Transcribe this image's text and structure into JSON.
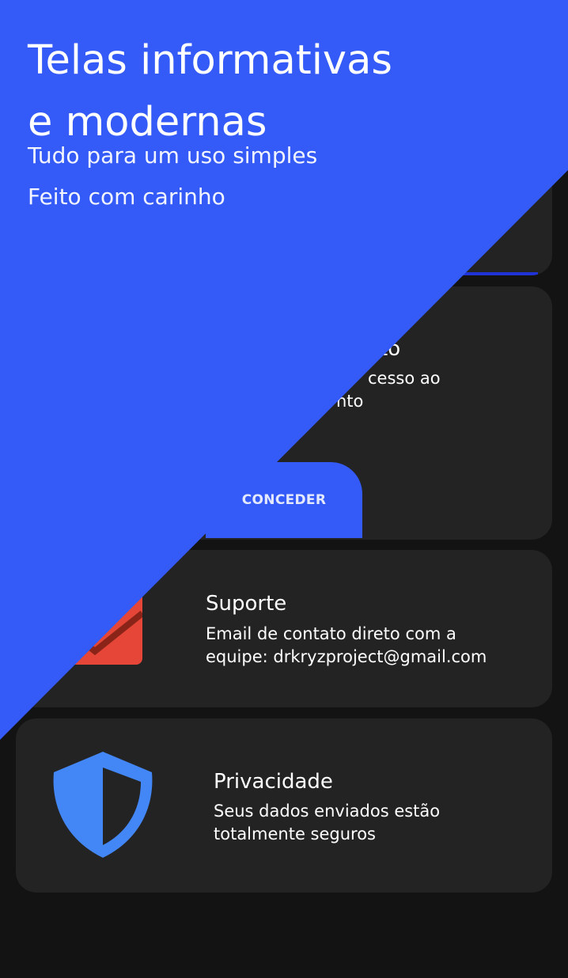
{
  "hero": {
    "title_line1": "Telas informativas",
    "title_line2": "e modernas",
    "subtitle_1": "Tudo para um uso simples",
    "subtitle_2": "Feito com carinho"
  },
  "cards": {
    "permission": {
      "title_partial": "to",
      "desc_line1_partial": "cesso ao",
      "desc_line2_partial": "nto",
      "button_label": "CONCEDER"
    },
    "support": {
      "title": "Suporte",
      "desc_line1": "Email de contato direto com a",
      "desc_line2": "equipe: drkryzproject@gmail.com",
      "icon": "email-icon"
    },
    "privacy": {
      "title": "Privacidade",
      "desc_line1": "Seus dados enviados estão",
      "desc_line2": "totalmente seguros",
      "icon": "shield-icon"
    }
  },
  "colors": {
    "accent": "#345bf7",
    "background": "#131313",
    "card": "#232323",
    "shield": "#4287f5",
    "email_red": "#e64637"
  }
}
